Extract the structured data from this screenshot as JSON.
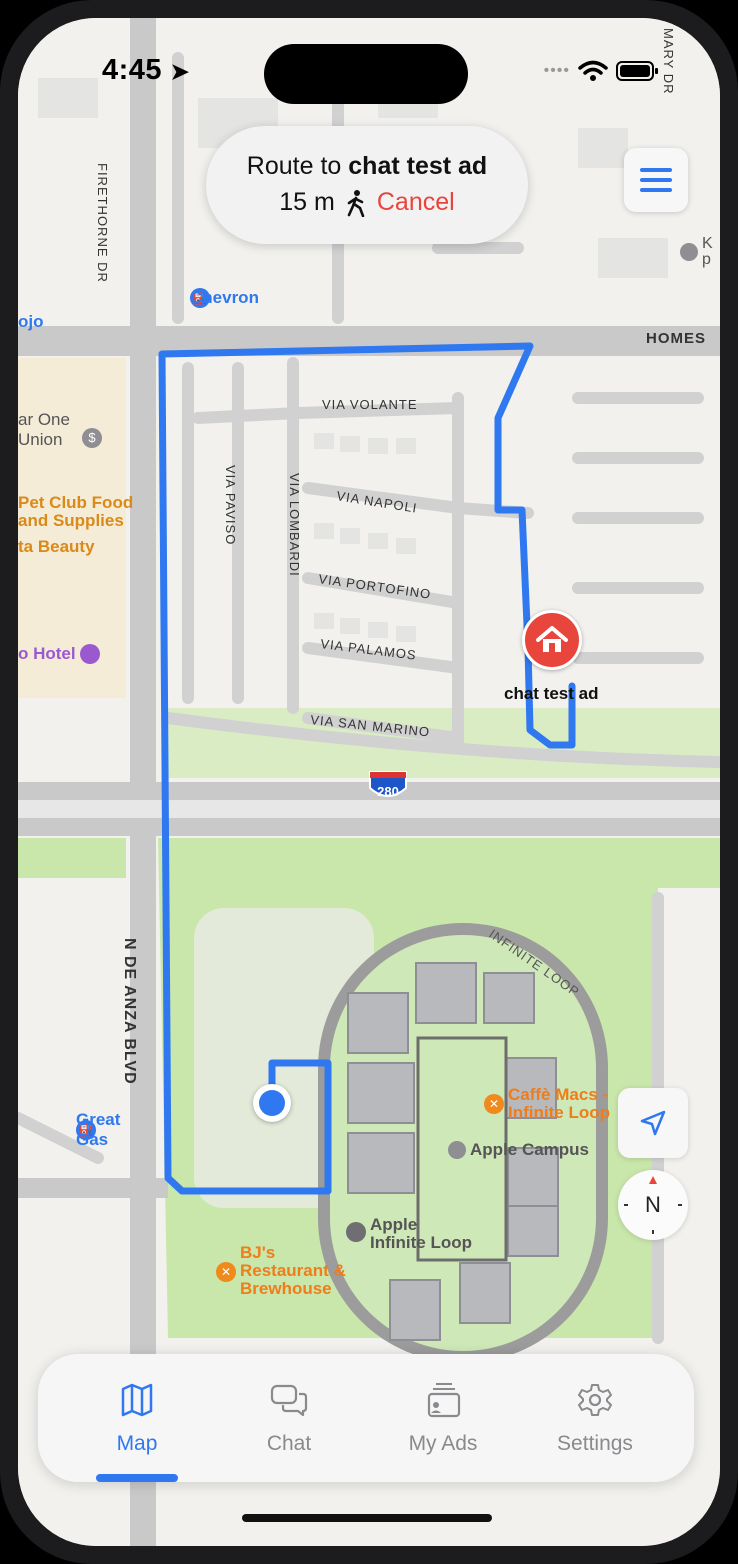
{
  "status_bar": {
    "time": "4:45"
  },
  "route": {
    "prefix": "Route to",
    "destination": "chat test ad",
    "distance": "15 m",
    "cancel_label": "Cancel"
  },
  "map": {
    "streets": {
      "firethorne": "FIRETHORNE DR",
      "homestead": "HOMES",
      "mary": "MARY DR",
      "via_volante": "VIA VOLANTE",
      "via_napoli": "VIA NAPOLI",
      "via_portofino": "VIA PORTOFINO",
      "via_palamos": "VIA PALAMOS",
      "via_san_marino": "VIA SAN MARINO",
      "via_paviso": "VIA PAVISO",
      "via_lombardi": "VIA LOMBARDI",
      "de_anza": "N DE ANZA BLVD",
      "infinite_loop": "INFINITE LOOP",
      "interstate": "280"
    },
    "pois": {
      "chevron": "Chevron",
      "great_gas": "Great Gas",
      "star_one_1": "ar One",
      "star_one_2": "Union",
      "pet_club_1": "Pet Club Food",
      "pet_club_2": "and Supplies",
      "beauty": "ta Beauty",
      "hotel": "o Hotel",
      "jojo": "ojo",
      "k_label_1": "K",
      "k_label_2": "p",
      "caffe_macs_1": "Caffè Macs -",
      "caffe_macs_2": "Infinite Loop",
      "apple_campus": "Apple Campus",
      "apple_il_1": "Apple",
      "apple_il_2": "Infinite Loop",
      "bjs_1": "BJ's",
      "bjs_2": "Restaurant &",
      "bjs_3": "Brewhouse",
      "ad_marker": "chat test ad"
    }
  },
  "controls": {
    "compass_label": "N"
  },
  "tabs": [
    {
      "label": "Map",
      "icon": "map-icon",
      "active": true
    },
    {
      "label": "Chat",
      "icon": "chat-icon",
      "active": false
    },
    {
      "label": "My Ads",
      "icon": "my-ads-icon",
      "active": false
    },
    {
      "label": "Settings",
      "icon": "gear-icon",
      "active": false
    }
  ],
  "colors": {
    "accent": "#2f78f0",
    "route": "#2f78f0",
    "cancel": "#e8453c",
    "marker": "#e8453c",
    "park": "#c7e6a8"
  }
}
